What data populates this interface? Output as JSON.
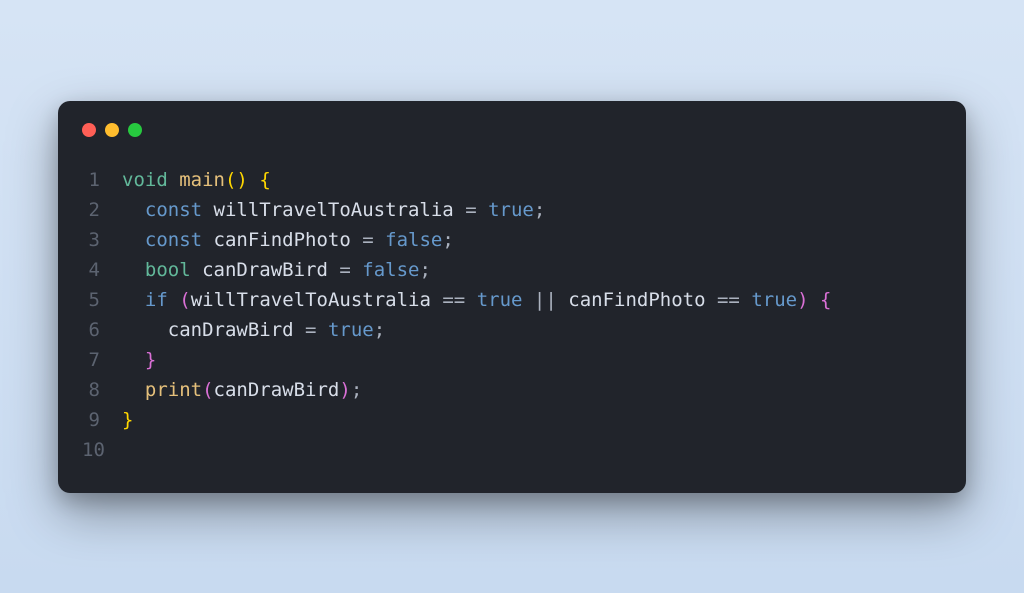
{
  "window": {
    "dots": [
      "red",
      "yellow",
      "green"
    ]
  },
  "code": {
    "lines": [
      {
        "n": "1",
        "tokens": [
          {
            "t": "void",
            "c": "tok-type"
          },
          {
            "t": " ",
            "c": "tok-punct"
          },
          {
            "t": "main",
            "c": "tok-func"
          },
          {
            "t": "()",
            "c": "tok-paren-yellow"
          },
          {
            "t": " ",
            "c": "tok-punct"
          },
          {
            "t": "{",
            "c": "tok-paren-yellow"
          }
        ]
      },
      {
        "n": "2",
        "tokens": [
          {
            "t": "  ",
            "c": "tok-punct"
          },
          {
            "t": "const",
            "c": "tok-keyword"
          },
          {
            "t": " willTravelToAustralia ",
            "c": "tok-ident"
          },
          {
            "t": "=",
            "c": "tok-op"
          },
          {
            "t": " ",
            "c": "tok-punct"
          },
          {
            "t": "true",
            "c": "tok-bool"
          },
          {
            "t": ";",
            "c": "tok-punct"
          }
        ]
      },
      {
        "n": "3",
        "tokens": [
          {
            "t": "  ",
            "c": "tok-punct"
          },
          {
            "t": "const",
            "c": "tok-keyword"
          },
          {
            "t": " canFindPhoto ",
            "c": "tok-ident"
          },
          {
            "t": "=",
            "c": "tok-op"
          },
          {
            "t": " ",
            "c": "tok-punct"
          },
          {
            "t": "false",
            "c": "tok-bool"
          },
          {
            "t": ";",
            "c": "tok-punct"
          }
        ]
      },
      {
        "n": "4",
        "tokens": [
          {
            "t": "  ",
            "c": "tok-punct"
          },
          {
            "t": "bool",
            "c": "tok-type"
          },
          {
            "t": " canDrawBird ",
            "c": "tok-ident"
          },
          {
            "t": "=",
            "c": "tok-op"
          },
          {
            "t": " ",
            "c": "tok-punct"
          },
          {
            "t": "false",
            "c": "tok-bool"
          },
          {
            "t": ";",
            "c": "tok-punct"
          }
        ]
      },
      {
        "n": "5",
        "tokens": [
          {
            "t": "  ",
            "c": "tok-punct"
          },
          {
            "t": "if",
            "c": "tok-keyword"
          },
          {
            "t": " ",
            "c": "tok-punct"
          },
          {
            "t": "(",
            "c": "tok-brace-pink"
          },
          {
            "t": "willTravelToAustralia ",
            "c": "tok-ident"
          },
          {
            "t": "==",
            "c": "tok-op"
          },
          {
            "t": " ",
            "c": "tok-punct"
          },
          {
            "t": "true",
            "c": "tok-bool"
          },
          {
            "t": " ",
            "c": "tok-punct"
          },
          {
            "t": "||",
            "c": "tok-op"
          },
          {
            "t": " canFindPhoto ",
            "c": "tok-ident"
          },
          {
            "t": "==",
            "c": "tok-op"
          },
          {
            "t": " ",
            "c": "tok-punct"
          },
          {
            "t": "true",
            "c": "tok-bool"
          },
          {
            "t": ")",
            "c": "tok-brace-pink"
          },
          {
            "t": " ",
            "c": "tok-punct"
          },
          {
            "t": "{",
            "c": "tok-brace-pink"
          }
        ]
      },
      {
        "n": "6",
        "tokens": [
          {
            "t": "    canDrawBird ",
            "c": "tok-ident"
          },
          {
            "t": "=",
            "c": "tok-op"
          },
          {
            "t": " ",
            "c": "tok-punct"
          },
          {
            "t": "true",
            "c": "tok-bool"
          },
          {
            "t": ";",
            "c": "tok-punct"
          }
        ]
      },
      {
        "n": "7",
        "tokens": [
          {
            "t": "  ",
            "c": "tok-punct"
          },
          {
            "t": "}",
            "c": "tok-brace-pink"
          }
        ]
      },
      {
        "n": "8",
        "tokens": [
          {
            "t": "  ",
            "c": "tok-punct"
          },
          {
            "t": "print",
            "c": "tok-func"
          },
          {
            "t": "(",
            "c": "tok-brace-pink"
          },
          {
            "t": "canDrawBird",
            "c": "tok-ident"
          },
          {
            "t": ")",
            "c": "tok-brace-pink"
          },
          {
            "t": ";",
            "c": "tok-punct"
          }
        ]
      },
      {
        "n": "9",
        "tokens": [
          {
            "t": "}",
            "c": "tok-paren-yellow"
          }
        ]
      },
      {
        "n": "10",
        "tokens": []
      }
    ]
  }
}
